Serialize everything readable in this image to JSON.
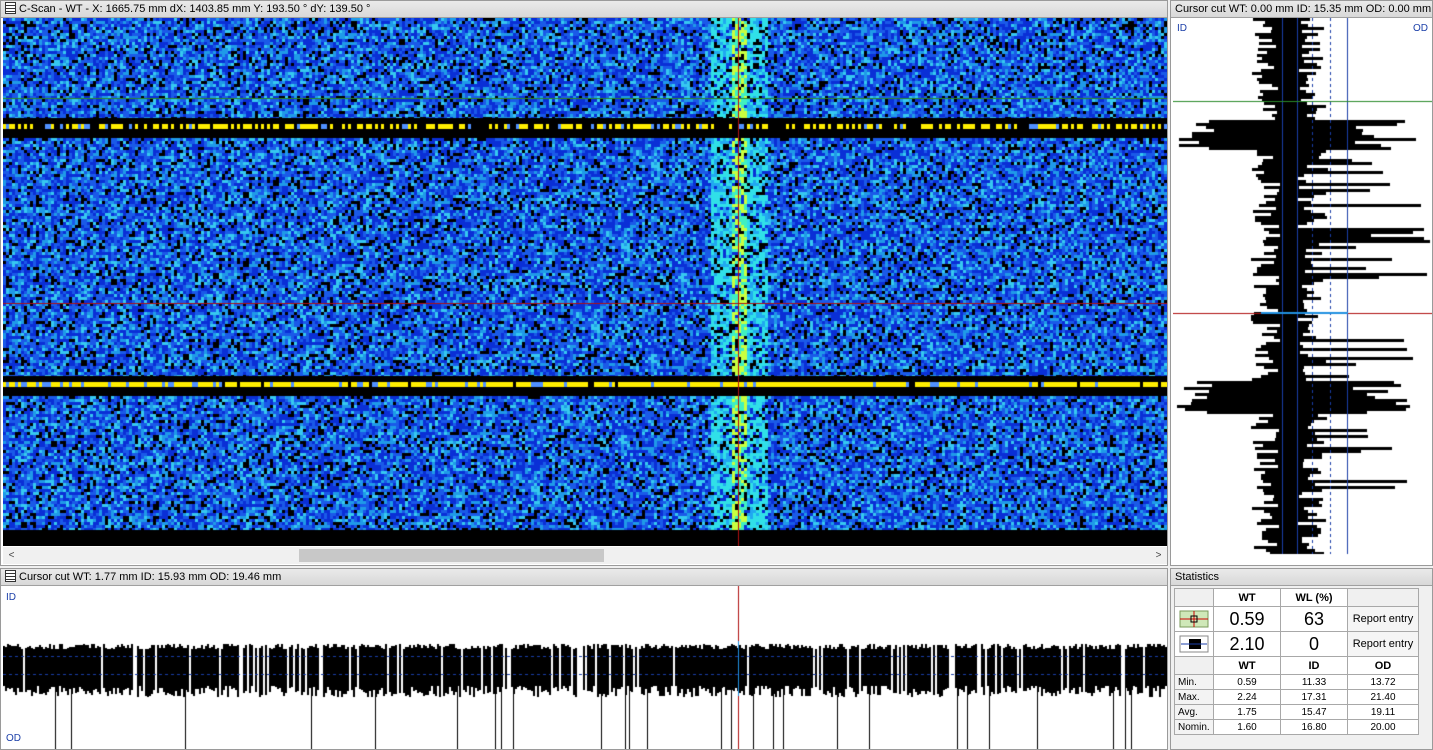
{
  "cscan": {
    "title": "C-Scan - WT  -  X: 1665.75 mm  dX: 1403.85 mm    Y: 193.50 °  dY: 139.50 °",
    "scroll_left": "<",
    "scroll_right": ">"
  },
  "vertical_cut": {
    "title": "Cursor cut  WT: 0.00 mm  ID: 15.35 mm  OD: 0.00 mm",
    "label_id": "ID",
    "label_od": "OD"
  },
  "horizontal_cut": {
    "title": "Cursor cut  WT: 1.77 mm  ID: 15.93 mm  OD: 19.46 mm",
    "label_id": "ID",
    "label_od": "OD"
  },
  "statistics": {
    "title": "Statistics",
    "top_headers": [
      "WT",
      "WL (%)"
    ],
    "cursor_rows": [
      {
        "icon": "cursor-point-icon",
        "wt": "0.59",
        "wl": "63",
        "button": "Report entry"
      },
      {
        "icon": "cursor-area-icon",
        "wt": "2.10",
        "wl": "0",
        "button": "Report entry"
      }
    ],
    "stat_headers": [
      "WT",
      "ID",
      "OD"
    ],
    "rows": [
      {
        "label": "Min.",
        "wt": "0.59",
        "id": "11.33",
        "od": "13.72"
      },
      {
        "label": "Max.",
        "wt": "2.24",
        "id": "17.31",
        "od": "21.40"
      },
      {
        "label": "Avg.",
        "wt": "1.75",
        "id": "15.47",
        "od": "19.11"
      },
      {
        "label": "Nomin.",
        "wt": "1.60",
        "id": "16.80",
        "od": "20.00"
      }
    ]
  },
  "colors": {
    "deep_blue": "#0a2fd6",
    "cyan": "#22c8f0",
    "yellow": "#ffee00",
    "cursor_red": "#b01010",
    "cursor_green": "#2a8a2a"
  }
}
